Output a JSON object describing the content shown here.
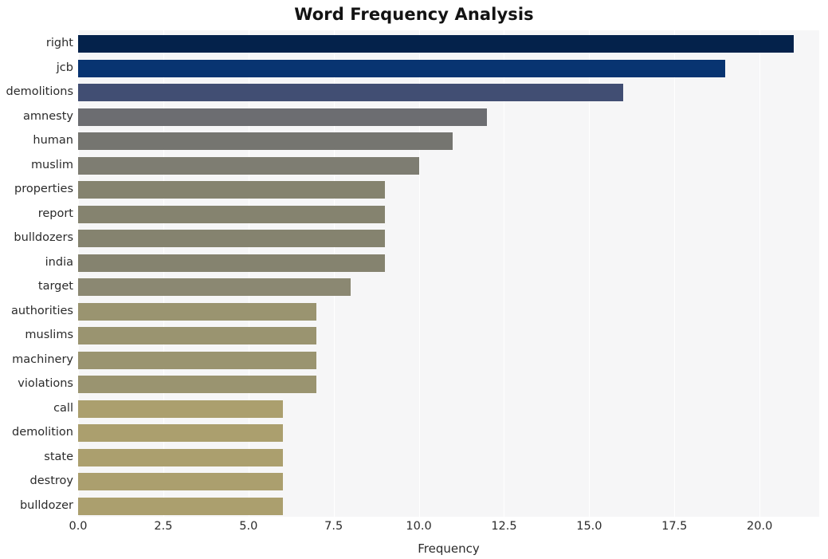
{
  "chart_data": {
    "type": "bar",
    "orientation": "horizontal",
    "title": "Word Frequency Analysis",
    "xlabel": "Frequency",
    "ylabel": "",
    "categories": [
      "right",
      "jcb",
      "demolitions",
      "amnesty",
      "human",
      "muslim",
      "properties",
      "report",
      "bulldozers",
      "india",
      "target",
      "authorities",
      "muslims",
      "machinery",
      "violations",
      "call",
      "demolition",
      "state",
      "destroy",
      "bulldozer"
    ],
    "values": [
      21,
      19,
      16,
      12,
      11,
      10,
      9,
      9,
      9,
      9,
      8,
      7,
      7,
      7,
      7,
      6,
      6,
      6,
      6,
      6
    ],
    "bar_colors": [
      "#04224b",
      "#083471",
      "#414e73",
      "#6c6d71",
      "#757570",
      "#7e7d72",
      "#85836f",
      "#85836f",
      "#85836f",
      "#85836f",
      "#8b8872",
      "#9a9470",
      "#9a9470",
      "#9a9470",
      "#9a9470",
      "#ab9f6e",
      "#ab9f6e",
      "#ab9f6e",
      "#ab9f6e",
      "#ab9f6e"
    ],
    "xticks": [
      0.0,
      2.5,
      5.0,
      7.5,
      10.0,
      12.5,
      15.0,
      17.5,
      20.0
    ],
    "xtick_labels": [
      "0.0",
      "2.5",
      "5.0",
      "7.5",
      "10.0",
      "12.5",
      "15.0",
      "17.5",
      "20.0"
    ],
    "xlim": [
      0,
      21.75
    ],
    "grid": true,
    "grid_axis": "x",
    "legend": "none",
    "plot_background": "#f6f6f7",
    "figure_background": "#ffffff"
  }
}
